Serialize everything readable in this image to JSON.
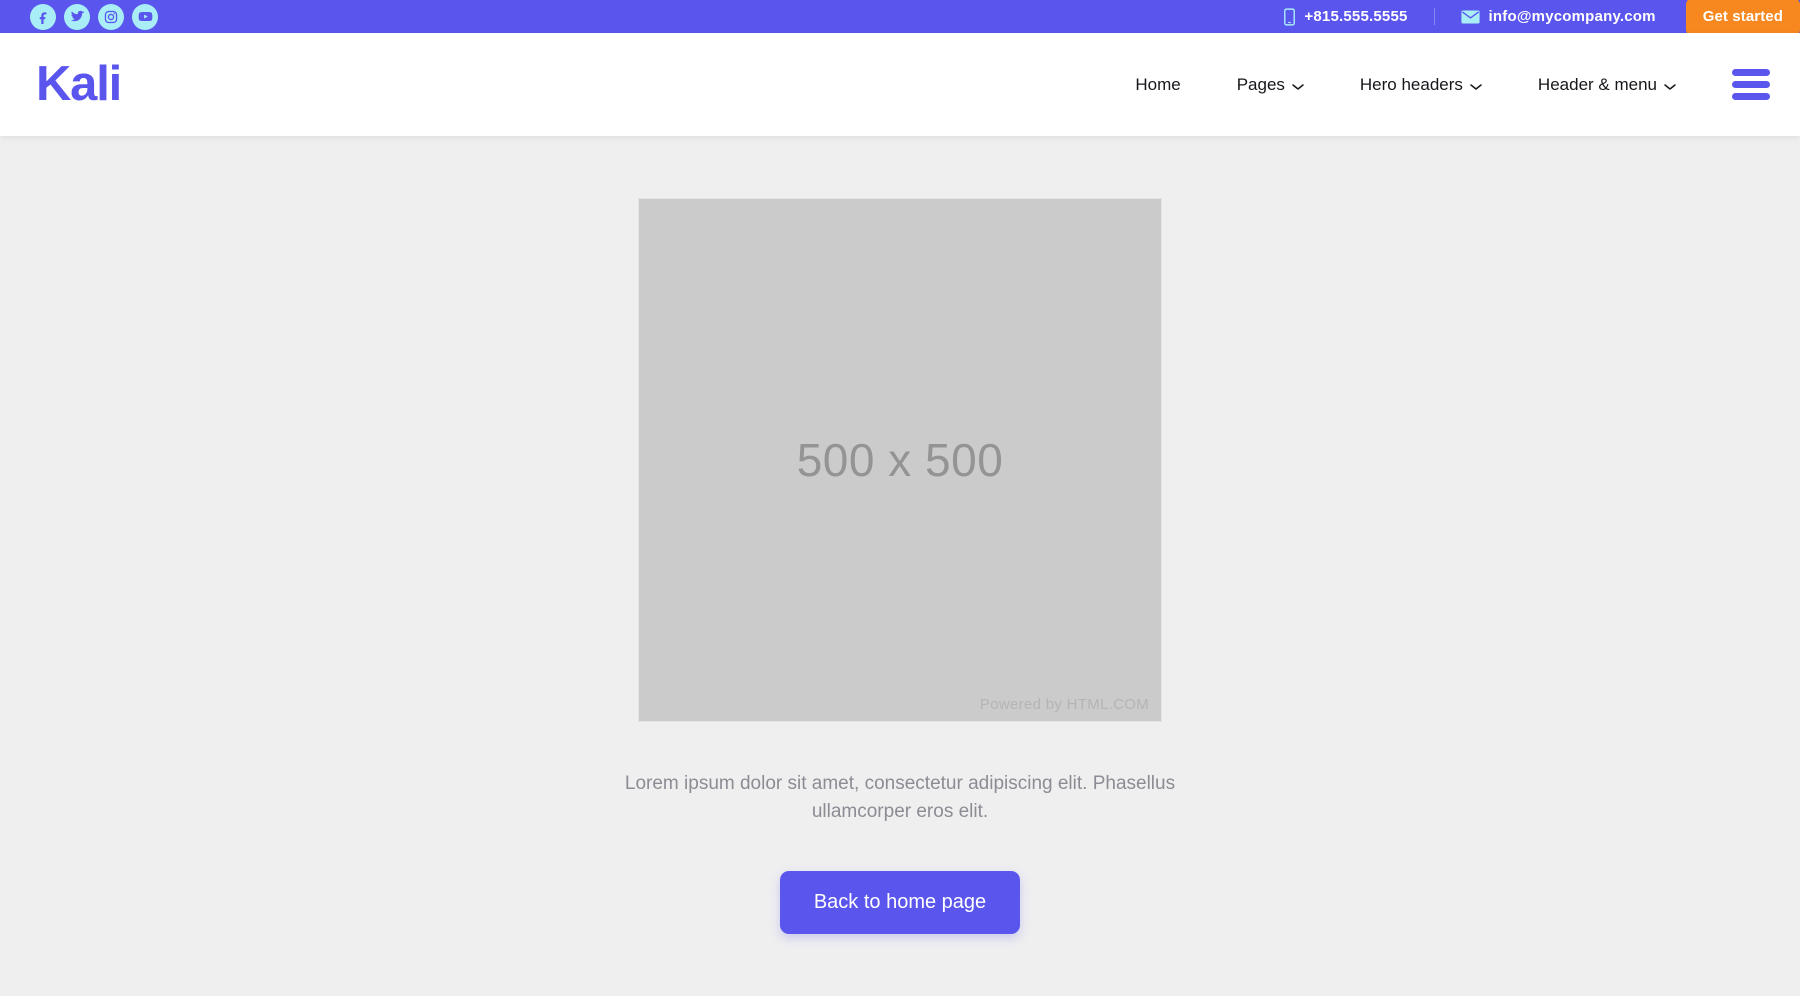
{
  "topbar": {
    "social": [
      {
        "name": "facebook-icon",
        "label": "Facebook"
      },
      {
        "name": "twitter-icon",
        "label": "Twitter"
      },
      {
        "name": "instagram-icon",
        "label": "Instagram"
      },
      {
        "name": "youtube-icon",
        "label": "YouTube"
      }
    ],
    "phone": "+815.555.5555",
    "email": "info@mycompany.com",
    "phone_icon": "mobile-phone-icon",
    "email_icon": "envelope-icon",
    "cta_label": "Get started",
    "bg_color": "#5a55ec",
    "cta_color": "#f7881f",
    "icon_color": "#a9eef7"
  },
  "header": {
    "logo": "Kali",
    "logo_color": "#5a55ec",
    "nav": [
      {
        "label": "Home",
        "has_caret": false
      },
      {
        "label": "Pages",
        "has_caret": true
      },
      {
        "label": "Hero headers",
        "has_caret": true
      },
      {
        "label": "Header & menu",
        "has_caret": true
      }
    ],
    "menu_toggle": "hamburger-icon"
  },
  "main": {
    "placeholder": {
      "size_label": "500 x 500",
      "credit": "Powered by HTML.COM"
    },
    "lead_text": "Lorem ipsum dolor sit amet, consectetur adipiscing elit. Phasellus ullamcorper eros elit.",
    "home_button_label": "Back to home page",
    "accent_color": "#5a55ec",
    "background_color": "#efeff0"
  }
}
